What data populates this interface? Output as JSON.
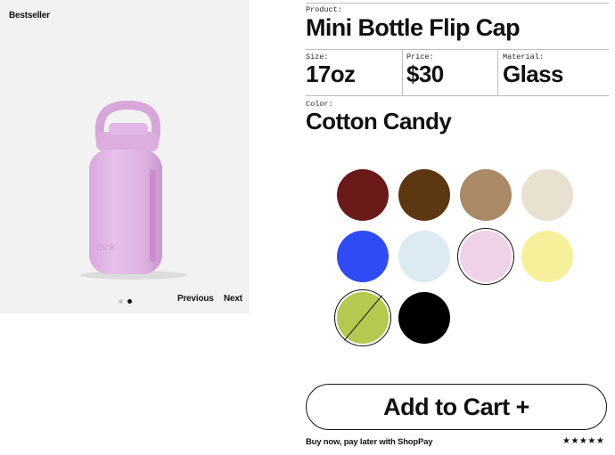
{
  "gallery": {
    "badge": "Bestseller",
    "bottle_brand": "Bink",
    "previous_label": "Previous",
    "next_label": "Next",
    "slides": 2,
    "active_slide": 2
  },
  "product": {
    "product_label": "Product:",
    "name": "Mini Bottle Flip Cap",
    "size_label": "Size:",
    "size": "17oz",
    "price_label": "Price:",
    "price": "$30",
    "material_label": "Material:",
    "material": "Glass",
    "color_label": "Color:",
    "color": "Cotton Candy"
  },
  "swatches": [
    {
      "color": "#6b1a1a",
      "selected": false,
      "sold_out": false
    },
    {
      "color": "#5c3712",
      "selected": false,
      "sold_out": false
    },
    {
      "color": "#a98a65",
      "selected": false,
      "sold_out": false
    },
    {
      "color": "#e8e1d0",
      "selected": false,
      "sold_out": false
    },
    {
      "color": "#2f4bf5",
      "selected": false,
      "sold_out": false
    },
    {
      "color": "#dceaf2",
      "selected": false,
      "sold_out": false
    },
    {
      "color": "#f0d2e8",
      "selected": true,
      "sold_out": false
    },
    {
      "color": "#f7f09a",
      "selected": false,
      "sold_out": false
    },
    {
      "color": "#b5c84f",
      "selected": false,
      "sold_out": true
    },
    {
      "color": "#000000",
      "selected": false,
      "sold_out": false
    }
  ],
  "cart": {
    "button_label": "Add to Cart +",
    "shoppay_text": "Buy now, pay later with ShopPay",
    "stars": "★★★★★"
  },
  "colors": {
    "background": "#ffffff",
    "card": "#f2f2f2",
    "bottle": "#e3b8e6"
  }
}
